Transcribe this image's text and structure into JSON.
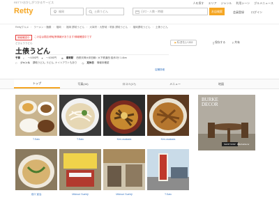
{
  "header": {
    "tagline": "RETTYおかしがつかるサービス",
    "top_links": [
      "人を探す",
      "エリア",
      "ジャンル",
      "利用シーン",
      "グルメニュース"
    ],
    "logo": "Retty",
    "area_input": "福岡",
    "keyword_input": "土俵うどん",
    "date_input": "日付・人数・時間",
    "search_button": "お店検索",
    "register_link": "会員登録",
    "login_link": "ログイン"
  },
  "breadcrumbs": [
    "Rettyグルメ",
    "ラーメン・麺類",
    "福岡",
    "福岡 讃岐うどん",
    "大宰府・大野城・筑紫 讃岐うどん",
    "福岡讃岐うどん",
    "土俵うどん"
  ],
  "notice": {
    "badge": "情報確認中",
    "text": "この店は閉店/移転等情報があります/情報確認中です"
  },
  "restaurant": {
    "kana": "どひょううどん",
    "name": "土俵うどん",
    "want_to_go_button": "行きたい 222",
    "save_button": "保存する",
    "share_button": "共有"
  },
  "info": {
    "budget_label": "予算",
    "budget_lunch": "～1000円",
    "budget_dinner": "～1000円",
    "station_label": "最寄駅",
    "station": "西鉄天神大牟田線 / 大下鉄道西 徒歩2分 1.4km",
    "genre_label": "ジャンル",
    "genre": "讃岐うどん, うどん, ナイトアウトもあり",
    "payment_label": "定休日",
    "payment": "情報未確認",
    "more_link": "店舗詳細"
  },
  "tabs": [
    "トップ",
    "写真(44)",
    "口コミ(17)",
    "メニュー",
    "地図"
  ],
  "photos": [
    {
      "caption": "T.Sato"
    },
    {
      "caption": "T.Sato"
    },
    {
      "caption": "Ken-osakada"
    },
    {
      "caption": "Ken-osakada"
    },
    {
      "caption": "池口 宣治"
    },
    {
      "caption": "Mikinori Suehiji"
    },
    {
      "caption": "Mikinori Suehiji"
    },
    {
      "caption": "T.Sato"
    }
  ],
  "ad": {
    "brand_line1": "BURKE",
    "brand_line2": "DECOR",
    "cta": "SHOP NOW",
    "handle": "#BurkeDecor"
  },
  "colors": {
    "accent": "#f5a623",
    "link": "#3b78c3",
    "alert": "#e53935"
  }
}
